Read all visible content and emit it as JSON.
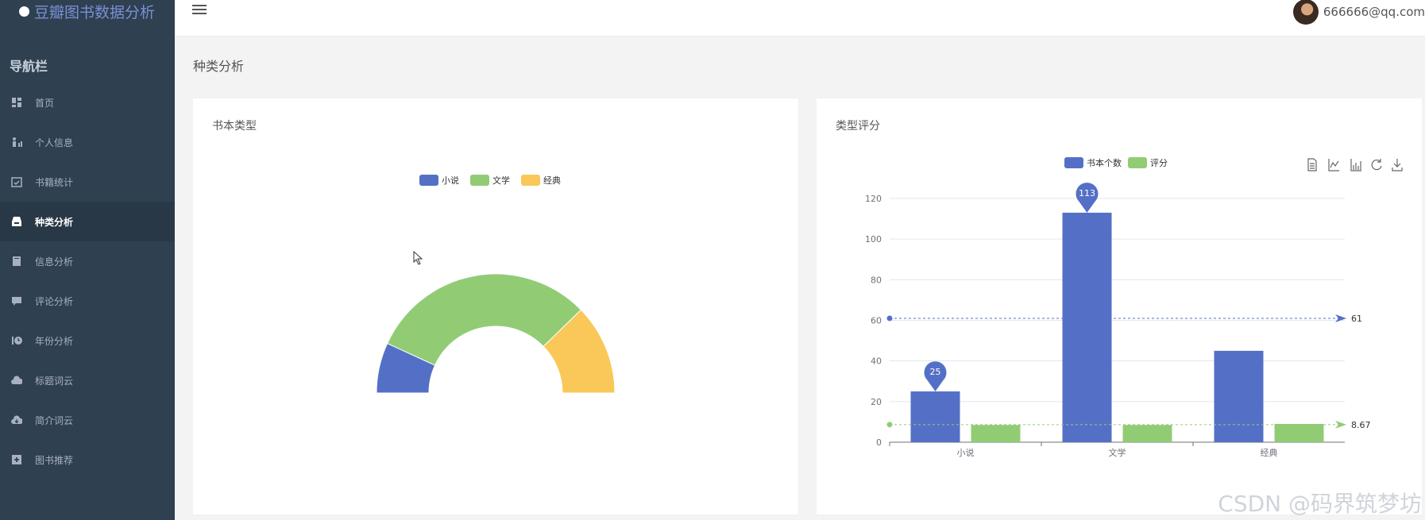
{
  "app": {
    "title": "豆瓣图书数据分析"
  },
  "nav": {
    "title": "导航栏",
    "items": [
      {
        "label": "首页",
        "icon": "dashboard-icon"
      },
      {
        "label": "个人信息",
        "icon": "user-icon"
      },
      {
        "label": "书籍统计",
        "icon": "calendar-icon"
      },
      {
        "label": "种类分析",
        "icon": "inbox-icon",
        "active": true
      },
      {
        "label": "信息分析",
        "icon": "book-icon"
      },
      {
        "label": "评论分析",
        "icon": "comment-icon"
      },
      {
        "label": "年份分析",
        "icon": "history-icon"
      },
      {
        "label": "标题词云",
        "icon": "cloud-icon"
      },
      {
        "label": "简介词云",
        "icon": "cloud-download-icon"
      },
      {
        "label": "图书推荐",
        "icon": "plus-square-icon"
      }
    ]
  },
  "user": {
    "email": "666666@qq.com"
  },
  "page": {
    "title": "种类分析"
  },
  "left_card": {
    "title": "书本类型"
  },
  "right_card": {
    "title": "类型评分"
  },
  "watermark": "CSDN @码界筑梦坊",
  "colors": {
    "blue": "#5470c6",
    "green": "#91cc75",
    "yellow": "#fac858"
  },
  "chart_data": [
    {
      "type": "pie",
      "variant": "half-donut",
      "legend": [
        "小说",
        "文学",
        "经典"
      ],
      "categories": [
        "小说",
        "文学",
        "经典"
      ],
      "values": [
        25,
        113,
        45
      ]
    },
    {
      "type": "bar",
      "legend": [
        "书本个数",
        "评分"
      ],
      "categories": [
        "小说",
        "文学",
        "经典"
      ],
      "series": [
        {
          "name": "书本个数",
          "values": [
            25,
            113,
            45
          ]
        },
        {
          "name": "评分",
          "values": [
            8.5,
            8.5,
            9
          ]
        }
      ],
      "ylim": [
        0,
        120
      ],
      "yticks": [
        0,
        20,
        40,
        60,
        80,
        100,
        120
      ],
      "markpoints": [
        25,
        113
      ],
      "marklines": [
        {
          "series": "书本个数",
          "label": "61",
          "value": 61
        },
        {
          "series": "评分",
          "label": "8.67",
          "value": 8.67
        }
      ],
      "toolbox": [
        "data-view-icon",
        "line-chart-icon",
        "bar-chart-icon",
        "restore-icon",
        "download-icon"
      ]
    }
  ]
}
